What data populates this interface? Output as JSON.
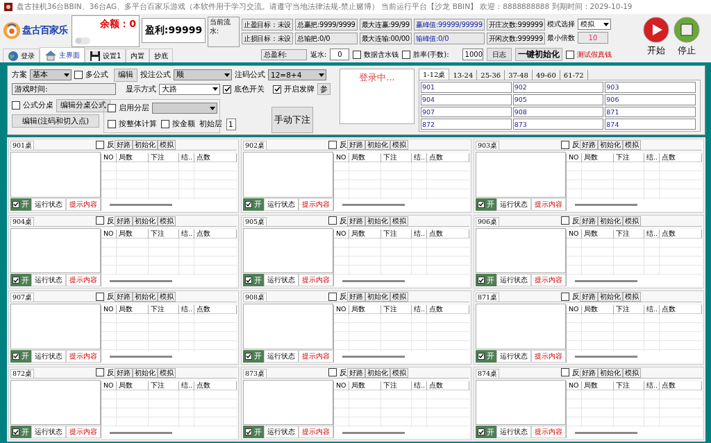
{
  "window": {
    "title": "盘古挂机36台BBIN、36台AG、多平台百家乐游戏（本软件用于学习交流。请遵守当地法律法规-禁止赌博） 当前运行平台【沙龙 BBIN】 欢迎：8888888888 到期时间：2029-10-19"
  },
  "header": {
    "logo_text": "盘古百家乐",
    "balance": "余额：0",
    "profit": "盈利:99999",
    "current_flow": "当前流水:",
    "stats": [
      {
        "text": "止盈目标：未设",
        "kind": "plain"
      },
      {
        "text": "总赢把:9999/9999",
        "kind": "plain"
      },
      {
        "text": "最大连赢:99/99",
        "kind": "plain"
      },
      {
        "text": "赢峰值:99999/99999",
        "kind": "peak"
      },
      {
        "text": "开庄次数:999999",
        "kind": "plain"
      },
      {
        "text": "止损目标：未设",
        "kind": "plain"
      },
      {
        "text": "总输把:0/0",
        "kind": "plain"
      },
      {
        "text": "最大连输:00/00",
        "kind": "plain"
      },
      {
        "text": "输峰值:0/0",
        "kind": "peak"
      },
      {
        "text": "开闲次数:999999",
        "kind": "plain"
      }
    ],
    "mode": {
      "label": "模式选择",
      "value": "模拟"
    },
    "min_multiple": {
      "label": "最小倍数",
      "value": "10"
    },
    "start_button": "开始",
    "stop_button": "停止",
    "tabs": [
      {
        "label": "登录",
        "selected": false
      },
      {
        "label": "主界面",
        "selected": true
      },
      {
        "label": "设置1",
        "selected": false
      },
      {
        "label": "内置",
        "selected": false
      },
      {
        "label": "抄底",
        "selected": false
      }
    ],
    "total_profit": "总盈利:",
    "rebate": {
      "label": "返水:",
      "value": "0"
    },
    "include_rebate": {
      "label": "数据含水钱",
      "checked": false
    },
    "win_rate": {
      "label": "胜率(手数):",
      "checked": false
    },
    "hands": "1000",
    "log_button": "日志",
    "reset_button": "一键初始化",
    "test_money": {
      "label": "测试假真钱",
      "checked": false
    }
  },
  "control": {
    "scheme": {
      "label": "方案",
      "value": "基本"
    },
    "multi_formula": {
      "label": "多公式",
      "checked": false
    },
    "edit_button": "编辑",
    "bet_formula": {
      "label": "投注公式",
      "value": "顺"
    },
    "stake_formula": {
      "label": "注码公式",
      "value": "12=8+4"
    },
    "game_time": "游戏时间:",
    "display_mode": {
      "label": "显示方式",
      "value": "大路"
    },
    "bg_color": {
      "label": "底色开关",
      "checked": true
    },
    "dealing": {
      "label": "开启发牌",
      "checked": true
    },
    "params_button": "参",
    "formula_split": {
      "label": "公式分桌",
      "checked": false
    },
    "edit_split_button": "编辑分桌公式",
    "edit_stake_button": "编辑(注码和切入点)",
    "layering": {
      "label": "启用分层",
      "checked": false
    },
    "whole_calc": {
      "label": "按整体计算",
      "checked": false
    },
    "by_amount": {
      "label": "按金额",
      "checked": false
    },
    "initial_layer": {
      "label": "初始层",
      "value": "1"
    },
    "manual_bet_button": "手动下注",
    "login_status": "登录中...",
    "table_tabs": [
      {
        "label": "1-12桌",
        "selected": true
      },
      {
        "label": "13-24",
        "selected": false
      },
      {
        "label": "25-36",
        "selected": false
      },
      {
        "label": "37-48",
        "selected": false
      },
      {
        "label": "49-60",
        "selected": false
      },
      {
        "label": "61-72",
        "selected": false
      }
    ],
    "tables": [
      "901",
      "902",
      "903",
      "904",
      "905",
      "906",
      "907",
      "908",
      "871",
      "872",
      "873",
      "874"
    ]
  },
  "panels": [
    {
      "name": "901桌",
      "reverse": {
        "label": "反",
        "checked": false
      },
      "buttons": [
        "好路",
        "初始化",
        "模拟"
      ],
      "columns": [
        "NO",
        "局数",
        "下注",
        "结..",
        "点数"
      ],
      "enabled": {
        "label": "开",
        "checked": true
      },
      "status": "运行状态",
      "hint": "提示内容"
    },
    {
      "name": "902桌",
      "reverse": {
        "label": "反",
        "checked": false
      },
      "buttons": [
        "好路",
        "初始化",
        "模拟"
      ],
      "columns": [
        "NO",
        "局数",
        "下注",
        "结..",
        "点数"
      ],
      "enabled": {
        "label": "开",
        "checked": true
      },
      "status": "运行状态",
      "hint": "提示内容"
    },
    {
      "name": "903桌",
      "reverse": {
        "label": "反",
        "checked": false
      },
      "buttons": [
        "好路",
        "初始化",
        "模拟"
      ],
      "columns": [
        "NO",
        "局数",
        "下注",
        "结..",
        "点数"
      ],
      "enabled": {
        "label": "开",
        "checked": true
      },
      "status": "运行状态",
      "hint": "提示内容"
    },
    {
      "name": "904桌",
      "reverse": {
        "label": "反",
        "checked": false
      },
      "buttons": [
        "好路",
        "初始化",
        "模拟"
      ],
      "columns": [
        "NO",
        "局数",
        "下注",
        "结..",
        "点数"
      ],
      "enabled": {
        "label": "开",
        "checked": true
      },
      "status": "运行状态",
      "hint": "提示内容"
    },
    {
      "name": "905桌",
      "reverse": {
        "label": "反",
        "checked": false
      },
      "buttons": [
        "好路",
        "初始化",
        "模拟"
      ],
      "columns": [
        "NO",
        "局数",
        "下注",
        "结..",
        "点数"
      ],
      "enabled": {
        "label": "开",
        "checked": true
      },
      "status": "运行状态",
      "hint": "提示内容"
    },
    {
      "name": "906桌",
      "reverse": {
        "label": "反",
        "checked": false
      },
      "buttons": [
        "好路",
        "初始化",
        "模拟"
      ],
      "columns": [
        "NO",
        "局数",
        "下注",
        "结..",
        "点数"
      ],
      "enabled": {
        "label": "开",
        "checked": true
      },
      "status": "运行状态",
      "hint": "提示内容"
    },
    {
      "name": "907桌",
      "reverse": {
        "label": "反",
        "checked": false
      },
      "buttons": [
        "好路",
        "初始化",
        "模拟"
      ],
      "columns": [
        "NO",
        "局数",
        "下注",
        "结..",
        "点数"
      ],
      "enabled": {
        "label": "开",
        "checked": true
      },
      "status": "运行状态",
      "hint": "提示内容"
    },
    {
      "name": "908桌",
      "reverse": {
        "label": "反",
        "checked": false
      },
      "buttons": [
        "好路",
        "初始化",
        "模拟"
      ],
      "columns": [
        "NO",
        "局数",
        "下注",
        "结..",
        "点数"
      ],
      "enabled": {
        "label": "开",
        "checked": true
      },
      "status": "运行状态",
      "hint": "提示内容"
    },
    {
      "name": "871桌",
      "reverse": {
        "label": "反",
        "checked": false
      },
      "buttons": [
        "好路",
        "初始化",
        "模拟"
      ],
      "columns": [
        "NO",
        "局数",
        "下注",
        "结..",
        "点数"
      ],
      "enabled": {
        "label": "开",
        "checked": true
      },
      "status": "运行状态",
      "hint": "提示内容"
    },
    {
      "name": "872桌",
      "reverse": {
        "label": "反",
        "checked": false
      },
      "buttons": [
        "好路",
        "初始化",
        "模拟"
      ],
      "columns": [
        "NO",
        "局数",
        "下注",
        "结..",
        "点数"
      ],
      "enabled": {
        "label": "开",
        "checked": true
      },
      "status": "运行状态",
      "hint": "提示内容"
    },
    {
      "name": "873桌",
      "reverse": {
        "label": "反",
        "checked": false
      },
      "buttons": [
        "好路",
        "初始化",
        "模拟"
      ],
      "columns": [
        "NO",
        "局数",
        "下注",
        "结..",
        "点数"
      ],
      "enabled": {
        "label": "开",
        "checked": true
      },
      "status": "运行状态",
      "hint": "提示内容"
    },
    {
      "name": "874桌",
      "reverse": {
        "label": "反",
        "checked": false
      },
      "buttons": [
        "好路",
        "初始化",
        "模拟"
      ],
      "columns": [
        "NO",
        "局数",
        "下注",
        "结..",
        "点数"
      ],
      "enabled": {
        "label": "开",
        "checked": true
      },
      "status": "运行状态",
      "hint": "提示内容"
    }
  ]
}
